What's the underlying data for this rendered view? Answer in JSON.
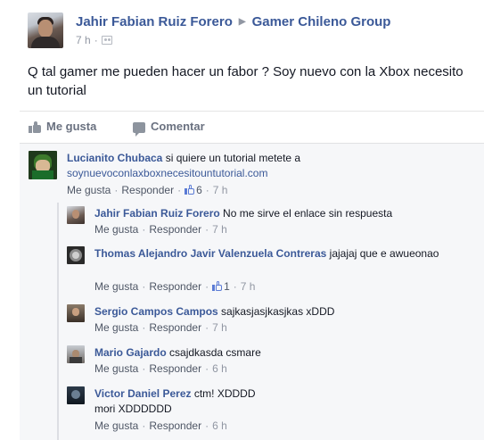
{
  "post": {
    "author": "Jahir Fabian Ruiz Forero",
    "group": "Gamer Chileno Group",
    "time": "7 h",
    "text": "Q tal gamer me pueden hacer un fabor ? Soy nuevo con la Xbox necesito un tutorial"
  },
  "actions": {
    "like_label": "Me gusta",
    "comment_label": "Comentar"
  },
  "comments": [
    {
      "author": "Lucianito Chubaca",
      "text": "si quiere un tutorial metete a",
      "link": "soynuevoconlaxboxnecesitountutorial.com",
      "like": "Me gusta",
      "reply": "Responder",
      "likes": "6",
      "time": "7 h"
    }
  ],
  "replies": [
    {
      "author": "Jahir Fabian Ruiz Forero",
      "text": "No me sirve el enlace sin respuesta",
      "like": "Me gusta",
      "reply": "Responder",
      "time": "7 h"
    },
    {
      "author": "Thomas Alejandro Javir Valenzuela Contreras",
      "text": "jajajaj que e awueonao",
      "like": "Me gusta",
      "reply": "Responder",
      "likes": "1",
      "time": "7 h"
    },
    {
      "author": "Sergio Campos Campos",
      "text": "sajkasjasjkasjkas xDDD",
      "like": "Me gusta",
      "reply": "Responder",
      "time": "7 h"
    },
    {
      "author": "Mario Gajardo",
      "text": "csajdkasda csmare",
      "like": "Me gusta",
      "reply": "Responder",
      "time": "6 h"
    },
    {
      "author": "Victor Daniel Perez",
      "text": "ctm! XDDDD",
      "text2": "mori XDDDDDD",
      "like": "Me gusta",
      "reply": "Responder",
      "time": "6 h"
    }
  ],
  "sep": "·",
  "arrow": "▶",
  "colors": {
    "link": "#3b5998",
    "muted": "#9197a3",
    "like_blue": "#5b7bd5"
  }
}
